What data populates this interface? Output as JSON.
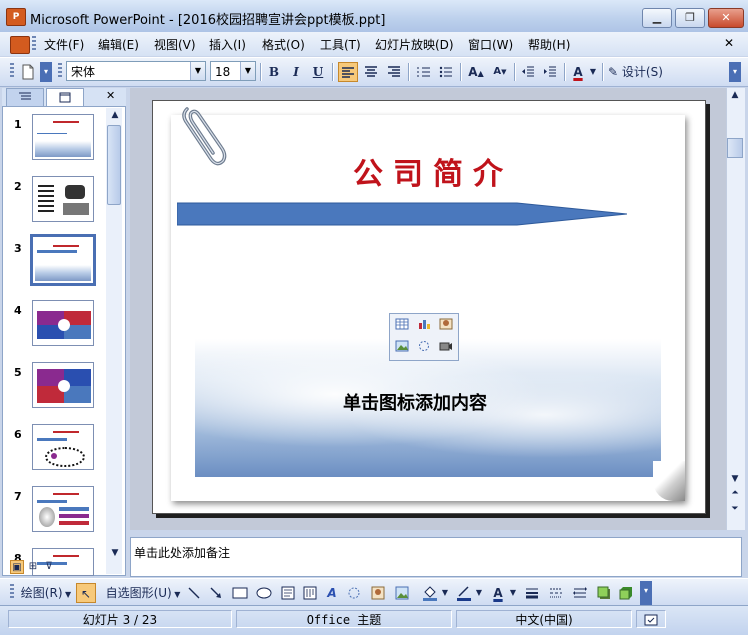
{
  "window": {
    "app_icon": "P",
    "title": "Microsoft PowerPoint - [2016校园招聘宣讲会ppt模板.ppt]",
    "controls": {
      "minimize": "▁",
      "restore": "❐",
      "close": "✕"
    }
  },
  "menu": {
    "items": [
      "文件(F)",
      "编辑(E)",
      "视图(V)",
      "插入(I)",
      "格式(O)",
      "工具(T)",
      "幻灯片放映(D)",
      "窗口(W)",
      "帮助(H)"
    ],
    "close_doc": "✕"
  },
  "toolbar": {
    "font_name": "宋体",
    "font_size": "18",
    "bold": "B",
    "italic": "I",
    "underline": "U",
    "design_label": "设计(S)",
    "font_color_label": "A"
  },
  "slides_panel": {
    "tab_outline_icon": "outline-icon",
    "tab_slides_icon": "slides-icon",
    "close": "✕",
    "thumbnails": [
      "1",
      "2",
      "3",
      "4",
      "5",
      "6",
      "7",
      "8"
    ],
    "selected": "3"
  },
  "slide": {
    "title": "公司简介",
    "placeholder_text": "单击图标添加内容",
    "content_icons": [
      "table-icon",
      "chart-icon",
      "clipart-icon",
      "picture-icon",
      "diagram-icon",
      "media-icon"
    ]
  },
  "notes": {
    "placeholder": "单击此处添加备注"
  },
  "drawing_toolbar": {
    "draw_label": "绘图(R)",
    "autoshapes_label": "自选图形(U)"
  },
  "statusbar": {
    "slide_position": "幻灯片 3 / 23",
    "theme": "Office 主题",
    "language": "中文(中国)"
  },
  "colors": {
    "accent_title": "#c0131b",
    "arrow_bar": "#4a78bd",
    "selection": "#4a6fb3"
  }
}
